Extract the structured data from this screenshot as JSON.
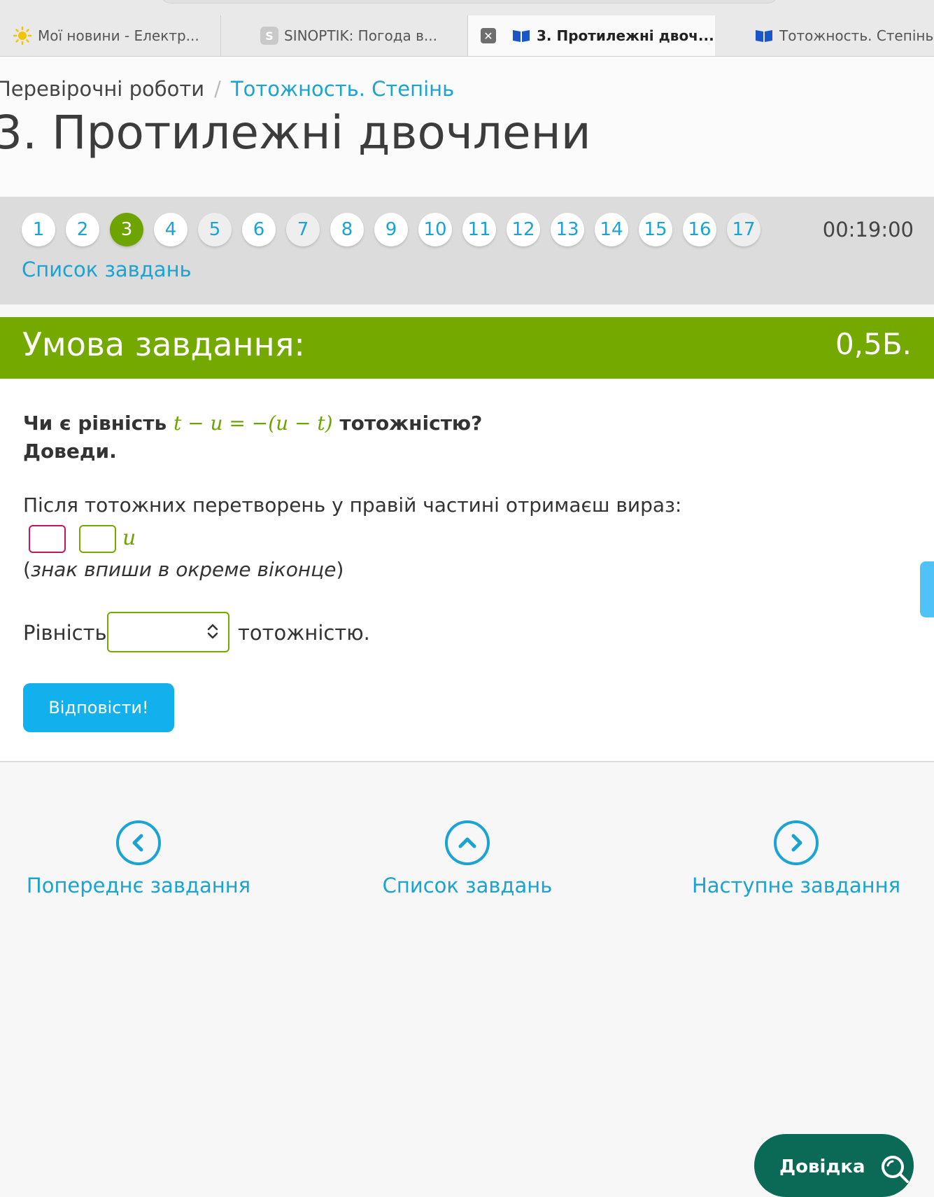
{
  "browser": {
    "tabs": [
      {
        "title": "Мої новини - Електр...",
        "icon": "sun-icon"
      },
      {
        "title": "SINOPTIK: Погода в...",
        "icon": "s-icon",
        "icon_text": "S"
      },
      {
        "title": "3. Протилежні двоч...",
        "icon": "book-icon",
        "active": true,
        "close_icon": "✕"
      },
      {
        "title": "Тотожность. Степінь",
        "icon": "book-icon"
      }
    ]
  },
  "breadcrumb": {
    "parent": "Перевірочні роботи",
    "separator": "/",
    "current": "Тотожность. Степінь"
  },
  "page_title": "3. Протилежні двочлени",
  "task_nav": {
    "numbers": [
      "1",
      "2",
      "3",
      "4",
      "5",
      "6",
      "7",
      "8",
      "9",
      "10",
      "11",
      "12",
      "13",
      "14",
      "15",
      "16",
      "17"
    ],
    "current": "3",
    "timer": "00:19:00",
    "task_list_link": "Список завдань"
  },
  "condition": {
    "header": "Умова завдання:",
    "points": "0,5Б.",
    "question_before": "Чи є рівність",
    "question_math": "t − u = −(u − t)",
    "question_after": "тотожністю?",
    "question_line2": "Доведи.",
    "instruction": "Після тотожних перетворень у правій частині отримаєш вираз:",
    "expr_var": "u",
    "hint_open": "(",
    "hint": "знак впиши в окреме віконце",
    "hint_close": ")",
    "equality_label": "Рівність",
    "equality_select_value": "",
    "equality_after": "тотожністю.",
    "answer_button": "Відповісти!"
  },
  "bottom_nav": {
    "prev": "Попереднє завдання",
    "list": "Список завдань",
    "next": "Наступне завдання"
  },
  "help_button": "Довідка",
  "colors": {
    "accent_green": "#74aa00",
    "link_blue": "#1aa3d3",
    "button_blue": "#12b0ec",
    "help_green": "#0a6a55",
    "box_pink": "#c2185b"
  }
}
